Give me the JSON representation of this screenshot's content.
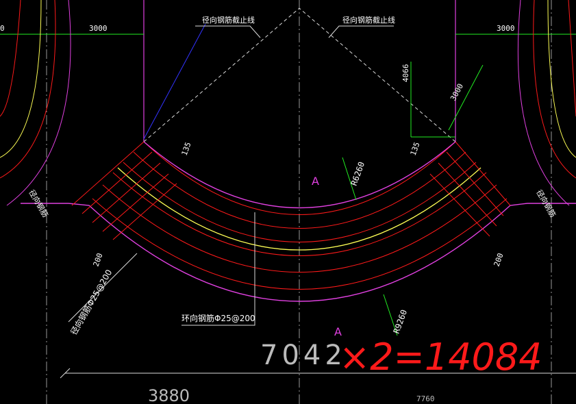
{
  "colors": {
    "background": "#000000",
    "rebar": "#ff1a1a",
    "boundary": "#e040e0",
    "centerline": "#ffff55",
    "dimension": "#22ee22",
    "text": "#ffffff",
    "axis": "#bbbbbb",
    "blueline": "#3333ff",
    "handwriting": "#ff1a1a"
  },
  "labels": {
    "cutoff_left": "径向钢筋截止线",
    "cutoff_right": "径向钢筋截止线",
    "radius_inner": "R6260",
    "radius_outer": "R9260",
    "ring_rebar": "环向钢筋Φ25@200",
    "radial_rebar": "径向钢筋Φ25@200",
    "radial_left_edge": "径向钢筋",
    "radial_right_edge": "径向钢筋",
    "section_mark_1": "A",
    "section_mark_2": "A"
  },
  "dimensions": {
    "top_left": "3000",
    "top_right": "3000",
    "top_far_left": "0",
    "vertical": "4066",
    "diagonal": "3000",
    "offset_left": "135",
    "offset_right": "135",
    "spacing_left": "200",
    "spacing_right": "200",
    "big_width": "7042",
    "bottom_left": "3880",
    "bottom_right": "7760"
  },
  "handwriting": "×2=14084"
}
